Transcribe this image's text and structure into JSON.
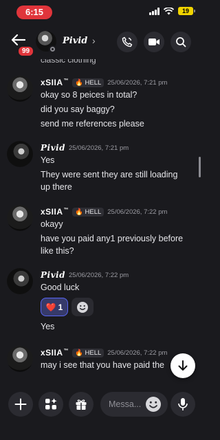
{
  "status_bar": {
    "time": "6:15",
    "battery": "19"
  },
  "header": {
    "unread_count": "99",
    "name": "Pivid",
    "chevron": "›"
  },
  "messages": {
    "cut_off_text": "classic clothing",
    "groups": [
      {
        "author": "xSIIA",
        "author_mark": "™",
        "tag": "HELL",
        "timestamp": "25/06/2026, 7:21 pm",
        "lines": [
          "okay so 8 peices in total?",
          "did you say baggy?",
          "send me references please"
        ]
      },
      {
        "author": "Pivid",
        "timestamp": "25/06/2026, 7:21 pm",
        "lines": [
          "Yes",
          "They were sent they are still loading",
          "up there"
        ]
      },
      {
        "author": "xSIIA",
        "author_mark": "™",
        "tag": "HELL",
        "timestamp": "25/06/2026, 7:22 pm",
        "lines": [
          "okayy",
          "have you paid any1 previously before",
          "like this?"
        ]
      },
      {
        "author": "Pivid",
        "timestamp": "25/06/2026, 7:22 pm",
        "lines": [
          "Good luck"
        ],
        "reaction": {
          "emoji": "❤️",
          "count": "1"
        },
        "after_reaction": "Yes"
      },
      {
        "author": "xSIIA",
        "author_mark": "™",
        "tag": "HELL",
        "timestamp": "25/06/2026, 7:22 pm",
        "lines": [
          "may i see that you have paid the"
        ]
      }
    ]
  },
  "composer": {
    "placeholder": "Messa..."
  },
  "icons": {
    "back": "arrow-left-icon",
    "call": "phone-icon",
    "video": "video-camera-icon",
    "search": "search-icon",
    "add": "plus-icon",
    "apps": "apps-icon",
    "gift": "gift-icon",
    "emoji": "emoji-icon",
    "mic": "microphone-icon",
    "jump": "arrow-down-icon"
  },
  "colors": {
    "accent": "#5865f2",
    "badge": "#e0353b",
    "background": "#1a1a1e"
  }
}
